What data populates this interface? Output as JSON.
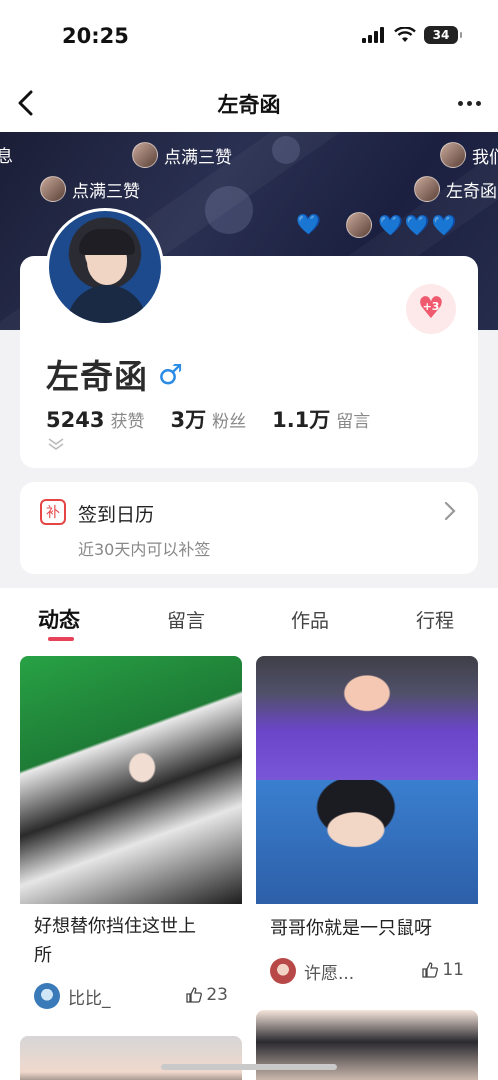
{
  "status_bar": {
    "time": "20:25",
    "battery": "34"
  },
  "nav": {
    "title": "左奇函"
  },
  "banner": {
    "danmu": [
      {
        "text": "息"
      },
      {
        "text": "点满三赞"
      },
      {
        "text": "我们"
      },
      {
        "text": "点满三赞"
      },
      {
        "text": "左奇函"
      }
    ],
    "hearts_left": "💙",
    "hearts_right": "💙💙💙"
  },
  "profile": {
    "name": "左奇函",
    "gender_symbol": "♂",
    "like_badge": "+3",
    "stats": [
      {
        "value": "5243",
        "label": "获赞"
      },
      {
        "value": "3万",
        "label": "粉丝"
      },
      {
        "value": "1.1万",
        "label": "留言"
      }
    ]
  },
  "checkin": {
    "icon_char": "补",
    "title": "签到日历",
    "subtitle": "近30天内可以补签"
  },
  "tabs": [
    {
      "label": "动态",
      "active": true
    },
    {
      "label": "留言",
      "active": false
    },
    {
      "label": "作品",
      "active": false
    },
    {
      "label": "行程",
      "active": false
    }
  ],
  "posts": [
    {
      "caption_line1": "好想替你挡住这世上",
      "caption_line2": "所",
      "author": "比比_",
      "likes": "23"
    },
    {
      "caption_line1": "哥哥你就是一只鼠呀",
      "author": "许愿...",
      "likes": "11"
    }
  ],
  "colors": {
    "accent": "#e8415a",
    "gender": "#2a8be6",
    "banner": "#1f2442"
  }
}
